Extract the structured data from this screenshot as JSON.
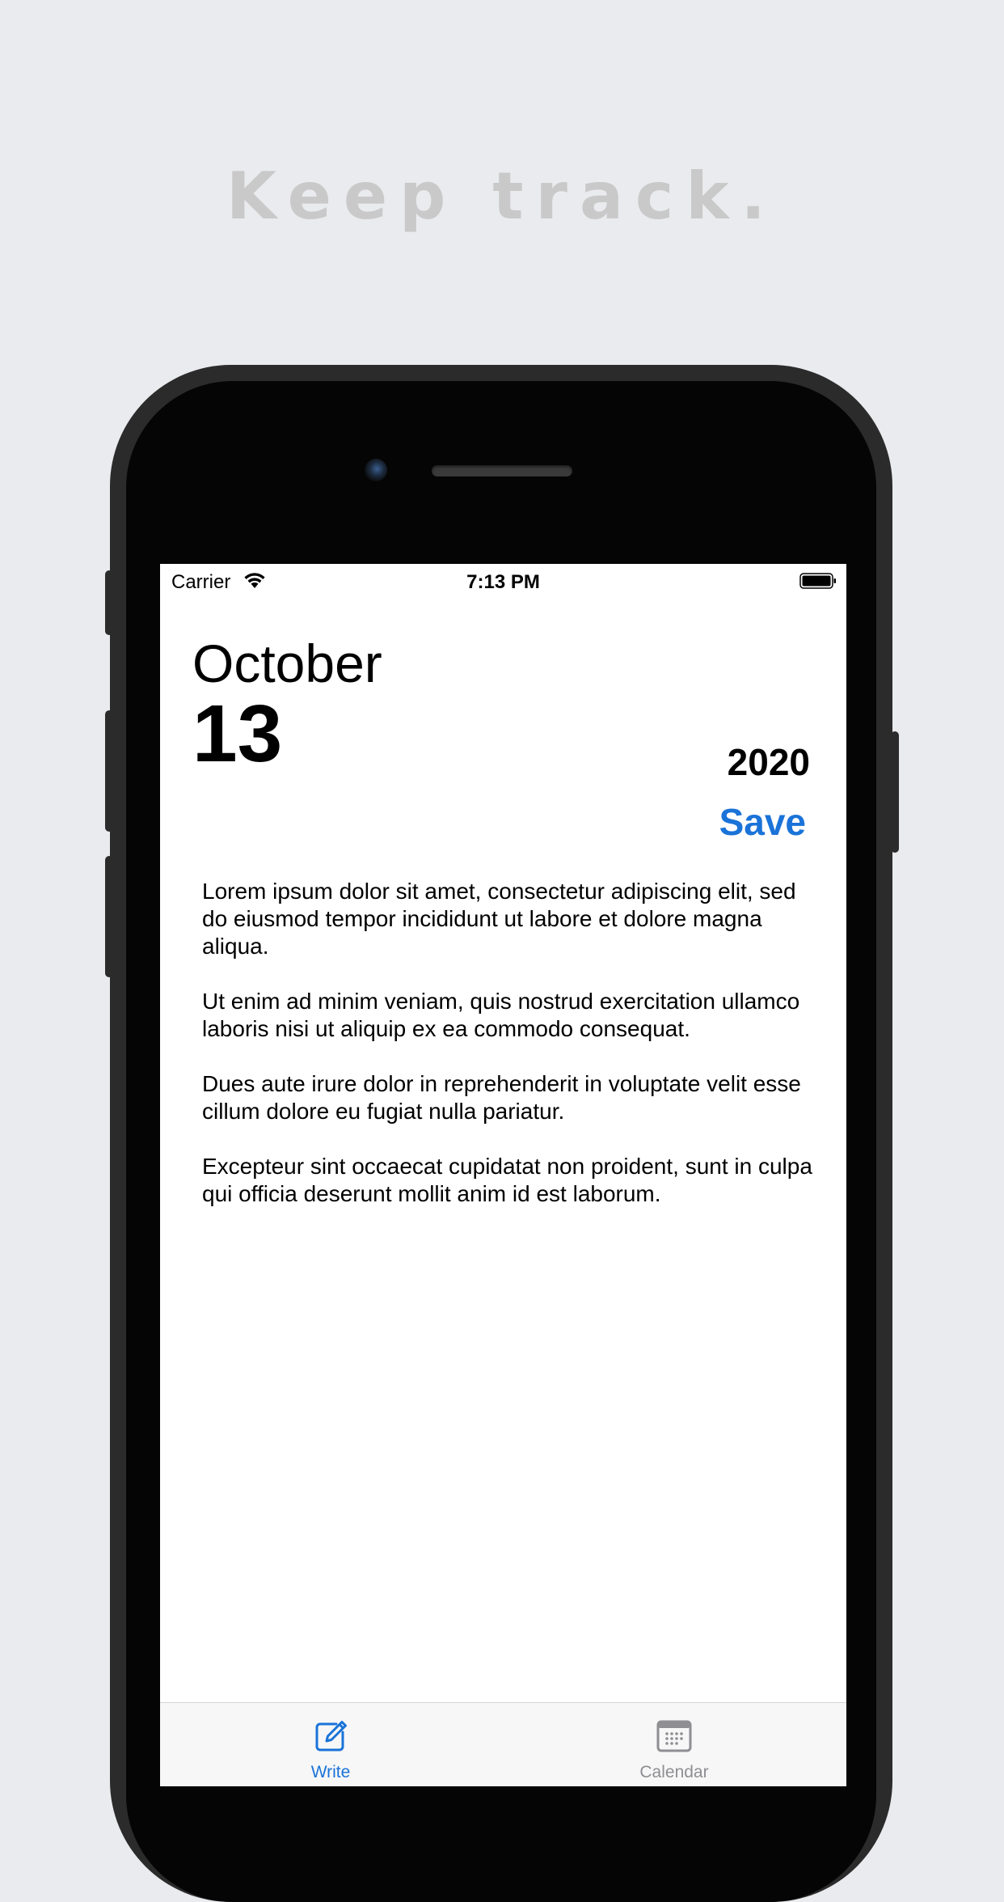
{
  "tagline": "Keep track.",
  "status_bar": {
    "carrier": "Carrier",
    "time": "7:13 PM",
    "icons": [
      "wifi-icon",
      "battery-icon"
    ]
  },
  "date": {
    "month": "October",
    "day": "13",
    "year": "2020"
  },
  "save_label": "Save",
  "entry": {
    "paragraphs": [
      "Lorem ipsum dolor sit amet, consectetur adipiscing elit, sed do eiusmod tempor incididunt ut labore et dolore magna aliqua.",
      "Ut enim ad minim veniam, quis nostrud exercitation ullamco laboris nisi ut aliquip ex ea commodo consequat.",
      "Dues aute irure dolor in reprehenderit in voluptate velit esse cillum dolore eu fugiat nulla pariatur.",
      "Excepteur sint occaecat cupidatat non proident, sunt in culpa qui officia deserunt mollit anim id est laborum."
    ]
  },
  "tabs": [
    {
      "label": "Write",
      "icon": "compose-icon",
      "selected": true
    },
    {
      "label": "Calendar",
      "icon": "calendar-icon",
      "selected": false
    }
  ],
  "colors": {
    "accent": "#1a73d8",
    "background": "#eaebee",
    "tagline": "#c9c9c9",
    "inactive_tab": "#8e8e93"
  }
}
